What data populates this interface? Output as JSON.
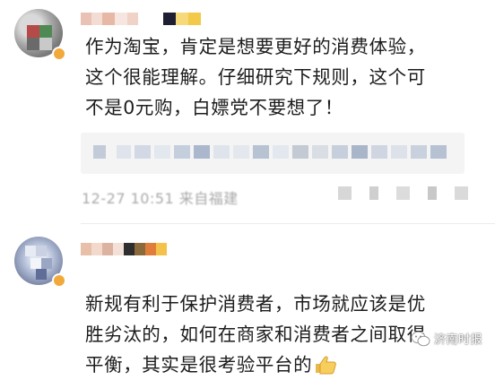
{
  "comments": [
    {
      "text": "作为淘宝，肯定是想要更好的消费体验，\n这个很能理解。仔细研究下规则，这个可\n不是0元购，白嫖党不要想了！",
      "time": "12-27 10:51 来自福建"
    },
    {
      "text": "新规有利于保护消费者，市场就应该是优\n胜劣汰的，如何在商家和消费者之间取得\n平衡，其实是很考验平台的",
      "emoji": "thumbs-up-emoji"
    }
  ],
  "watermark": {
    "text": "济南时报",
    "icon": "wechat-icon"
  },
  "colors": {
    "text": "#1c1c1c",
    "meta": "#a9a9a9",
    "quote_bg": "#f4f4f4",
    "badge": "#f2a93b"
  }
}
